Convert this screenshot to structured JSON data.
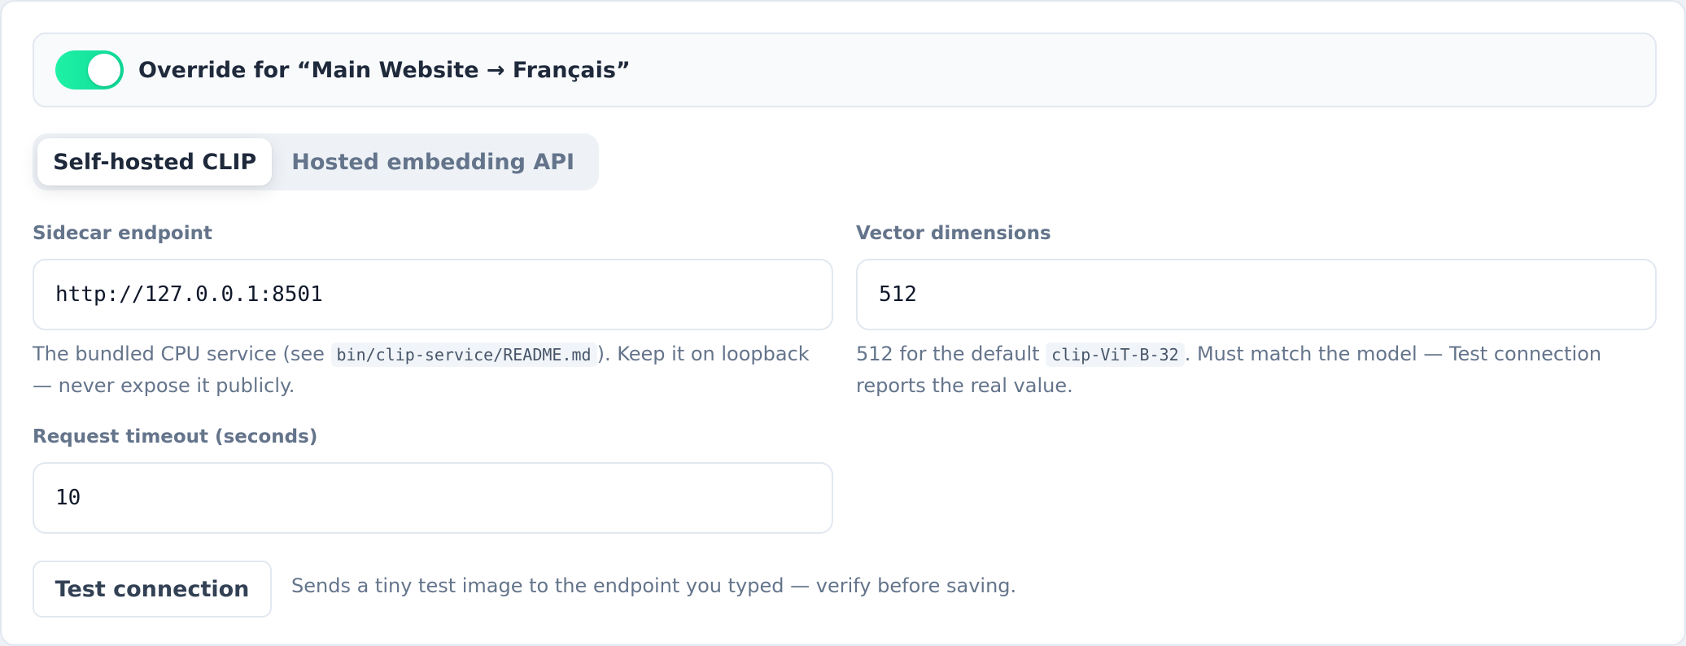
{
  "override": {
    "enabled": true,
    "label": "Override for “Main Website → Français”"
  },
  "mode_tabs": [
    {
      "label": "Self-hosted CLIP",
      "active": true
    },
    {
      "label": "Hosted embedding API",
      "active": false
    }
  ],
  "sidecar_endpoint": {
    "label": "Sidecar endpoint",
    "value": "http://127.0.0.1:8501",
    "help_prefix": "The bundled CPU service (see ",
    "help_code": "bin/clip-service/README.md",
    "help_suffix": "). Keep it on loopback — never expose it publicly."
  },
  "vector_dimensions": {
    "label": "Vector dimensions",
    "value": "512",
    "help_prefix": "512 for the default ",
    "help_code": "clip-ViT-B-32",
    "help_suffix": ". Must match the model — Test connection reports the real value."
  },
  "request_timeout": {
    "label": "Request timeout (seconds)",
    "value": "10"
  },
  "test_connection": {
    "button_label": "Test connection",
    "hint": "Sends a tiny test image to the endpoint you typed — verify before saving."
  },
  "colors": {
    "toggle_on": "#10d997",
    "text_primary": "#1e293b",
    "text_muted": "#64748b",
    "border": "#e2e8f0"
  }
}
